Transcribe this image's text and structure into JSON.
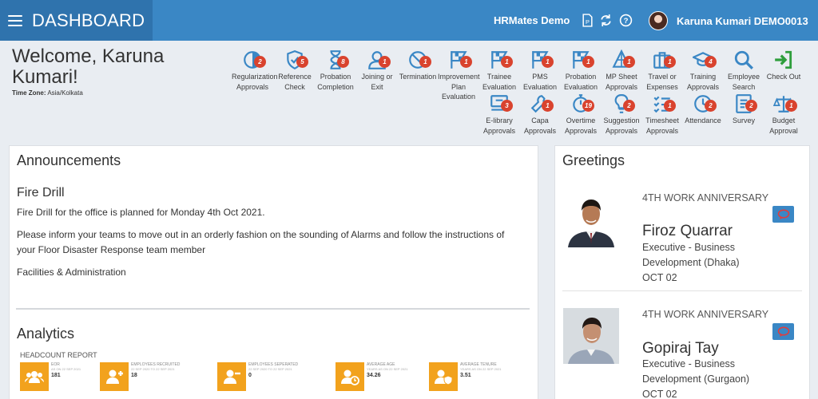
{
  "header": {
    "title": "DASHBOARD",
    "org_name": "HRMates Demo",
    "user_name": "Karuna Kumari DEMO0013",
    "icons": [
      "document-icon",
      "sync-icon",
      "help-icon"
    ]
  },
  "welcome": {
    "greeting": "Welcome, Karuna Kumari!",
    "timezone_label": "Time Zone:",
    "timezone_value": "Asia/Kolkata"
  },
  "tiles_row1": [
    {
      "label": "Regularization Approvals",
      "badge": "2",
      "icon": "pie-icon"
    },
    {
      "label": "Reference Check",
      "badge": "5",
      "icon": "shield-icon"
    },
    {
      "label": "Probation Completion",
      "badge": "8",
      "icon": "hourglass-icon"
    },
    {
      "label": "Joining or Exit",
      "badge": "1",
      "icon": "user-icon"
    },
    {
      "label": "Termination",
      "badge": "1",
      "icon": "ban-icon"
    },
    {
      "label": "Improvement Plan Evaluation",
      "badge": "1",
      "icon": "flag-icon"
    },
    {
      "label": "Trainee Evaluation",
      "badge": "1",
      "icon": "flag-icon"
    },
    {
      "label": "PMS Evaluation",
      "badge": "1",
      "icon": "flag-icon"
    },
    {
      "label": "Probation Evaluation",
      "badge": "1",
      "icon": "flag-icon"
    },
    {
      "label": "MP Sheet Approvals",
      "badge": "1",
      "icon": "sitemap-icon"
    },
    {
      "label": "Travel or Expenses",
      "badge": "1",
      "icon": "suitcase-icon"
    },
    {
      "label": "Training Approvals",
      "badge": "4",
      "icon": "graduation-icon"
    },
    {
      "label": "Employee Search",
      "badge": "",
      "icon": "search-icon"
    },
    {
      "label": "Check Out",
      "badge": "",
      "icon": "checkout-icon"
    }
  ],
  "tiles_row2": [
    {
      "label": "E-library Approvals",
      "badge": "3",
      "icon": "library-icon"
    },
    {
      "label": "Capa Approvals",
      "badge": "1",
      "icon": "wrench-icon"
    },
    {
      "label": "Overtime Approvals",
      "badge": "19",
      "icon": "stopwatch-icon"
    },
    {
      "label": "Suggestion Approvals",
      "badge": "2",
      "icon": "lightbulb-icon"
    },
    {
      "label": "Timesheet Approvals",
      "badge": "1",
      "icon": "tasks-icon"
    },
    {
      "label": "Attendance",
      "badge": "2",
      "icon": "clock-icon"
    },
    {
      "label": "Survey",
      "badge": "2",
      "icon": "survey-icon"
    },
    {
      "label": "Budget Approval",
      "badge": "1",
      "icon": "scale-icon"
    }
  ],
  "announcements": {
    "title": "Announcements",
    "heading": "Fire Drill",
    "p1": "Fire Drill for the office is planned for Monday 4th Oct 2021.",
    "p2": "Please inform your teams to move out in an orderly fashion on the sounding of Alarms and follow the instructions of your Floor Disaster Response team member",
    "p3": "Facilities & Administration"
  },
  "analytics": {
    "title": "Analytics",
    "report_title": "HEADCOUNT REPORT",
    "kpis": [
      {
        "label": "EOR",
        "sub": "AS ON 22 SEP 2021",
        "value": "181",
        "icon": "group-icon"
      },
      {
        "label": "EMPLOYEES RECRUITED",
        "sub": "22 SEP 2020 TO 22 SEP 2021",
        "value": "18",
        "icon": "user-plus-icon"
      },
      {
        "label": "EMPLOYEES SEPERATED",
        "sub": "22 SEP 2020 TO 22 SEP 2021",
        "value": "0",
        "icon": "user-minus-icon"
      },
      {
        "label": "AVERAGE AGE",
        "sub": "YEARS AS ON 22 SEP 2021",
        "value": "34.26",
        "icon": "user-clock-icon"
      },
      {
        "label": "AVERAGE TENURE",
        "sub": "YEARS AS ON 22 SEP 2021",
        "value": "3.51",
        "icon": "user-shield-icon"
      }
    ]
  },
  "greetings": {
    "title": "Greetings",
    "items": [
      {
        "kind": "4TH WORK ANNIVERSARY",
        "name": "Firoz Quarrar",
        "role1": "Executive - Business",
        "role2": "Development (Dhaka)",
        "date": "OCT 02"
      },
      {
        "kind": "4TH WORK ANNIVERSARY",
        "name": "Gopiraj Tay",
        "role1": "Executive - Business",
        "role2": "Development (Gurgaon)",
        "date": "OCT 02"
      }
    ]
  },
  "colors": {
    "primary": "#3a87c5",
    "primary_dark": "#2f73ad",
    "badge": "#d9432e",
    "kpi": "#f2a21d",
    "checkout": "#2e9e3c"
  }
}
